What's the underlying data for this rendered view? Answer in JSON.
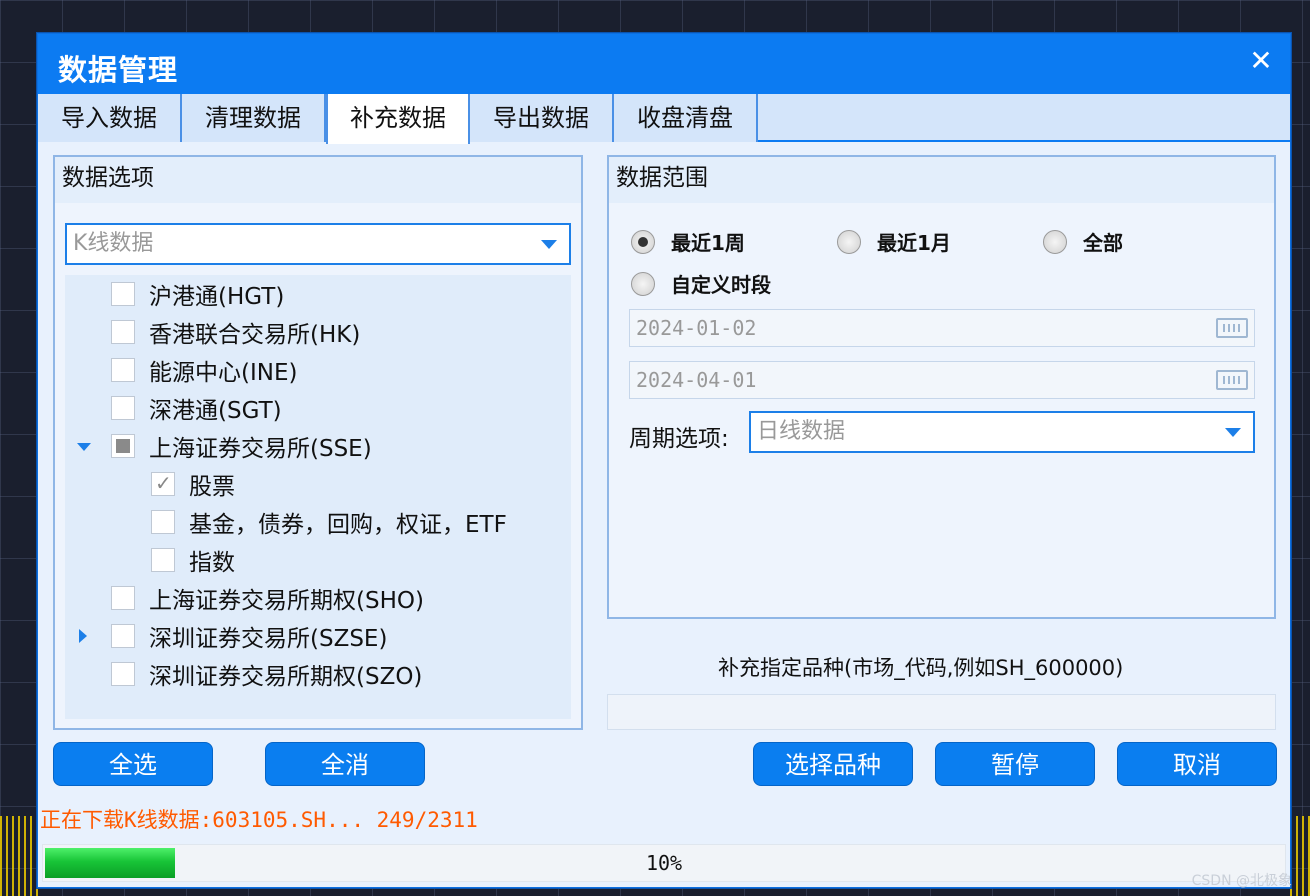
{
  "dialog": {
    "title": "数据管理",
    "close_icon": "close-icon"
  },
  "tabs": [
    "导入数据",
    "清理数据",
    "补充数据",
    "导出数据",
    "收盘清盘"
  ],
  "active_tab": "补充数据",
  "left_panel": {
    "title": "数据选项",
    "data_type": "K线数据",
    "tree": [
      {
        "label": "沪港通(HGT)",
        "state": "unchecked",
        "level": 0
      },
      {
        "label": "香港联合交易所(HK)",
        "state": "unchecked",
        "level": 0
      },
      {
        "label": "能源中心(INE)",
        "state": "unchecked",
        "level": 0
      },
      {
        "label": "深港通(SGT)",
        "state": "unchecked",
        "level": 0
      },
      {
        "label": "上海证券交易所(SSE)",
        "state": "partial",
        "level": 0,
        "expander": "expanded"
      },
      {
        "label": "股票",
        "state": "checked",
        "level": 1
      },
      {
        "label": "基金，债券，回购，权证，ETF",
        "state": "unchecked",
        "level": 1
      },
      {
        "label": "指数",
        "state": "unchecked",
        "level": 1
      },
      {
        "label": "上海证券交易所期权(SHO)",
        "state": "unchecked",
        "level": 0
      },
      {
        "label": "深圳证券交易所(SZSE)",
        "state": "unchecked",
        "level": 0,
        "expander": "collapsed"
      },
      {
        "label": "深圳证券交易所期权(SZO)",
        "state": "unchecked",
        "level": 0
      }
    ],
    "select_all": "全选",
    "clear_all": "全消"
  },
  "right_panel": {
    "title": "数据范围",
    "ranges": [
      {
        "label": "最近1周",
        "selected": true
      },
      {
        "label": "最近1月",
        "selected": false
      },
      {
        "label": "全部",
        "selected": false
      },
      {
        "label": "自定义时段",
        "selected": false
      }
    ],
    "start_date": "2024-01-02",
    "end_date": "2024-04-01",
    "period_label": "周期选项:",
    "period_value": "日线数据"
  },
  "supplement": {
    "label": "补充指定品种(市场_代码,例如SH_600000)",
    "value": ""
  },
  "buttons": {
    "select_variety": "选择品种",
    "pause": "暂停",
    "cancel": "取消"
  },
  "status": {
    "text": "正在下载K线数据:603105.SH... 249/2311"
  },
  "progress": {
    "fraction": 0.1,
    "label": "10%"
  },
  "watermark": "CSDN @北极象"
}
